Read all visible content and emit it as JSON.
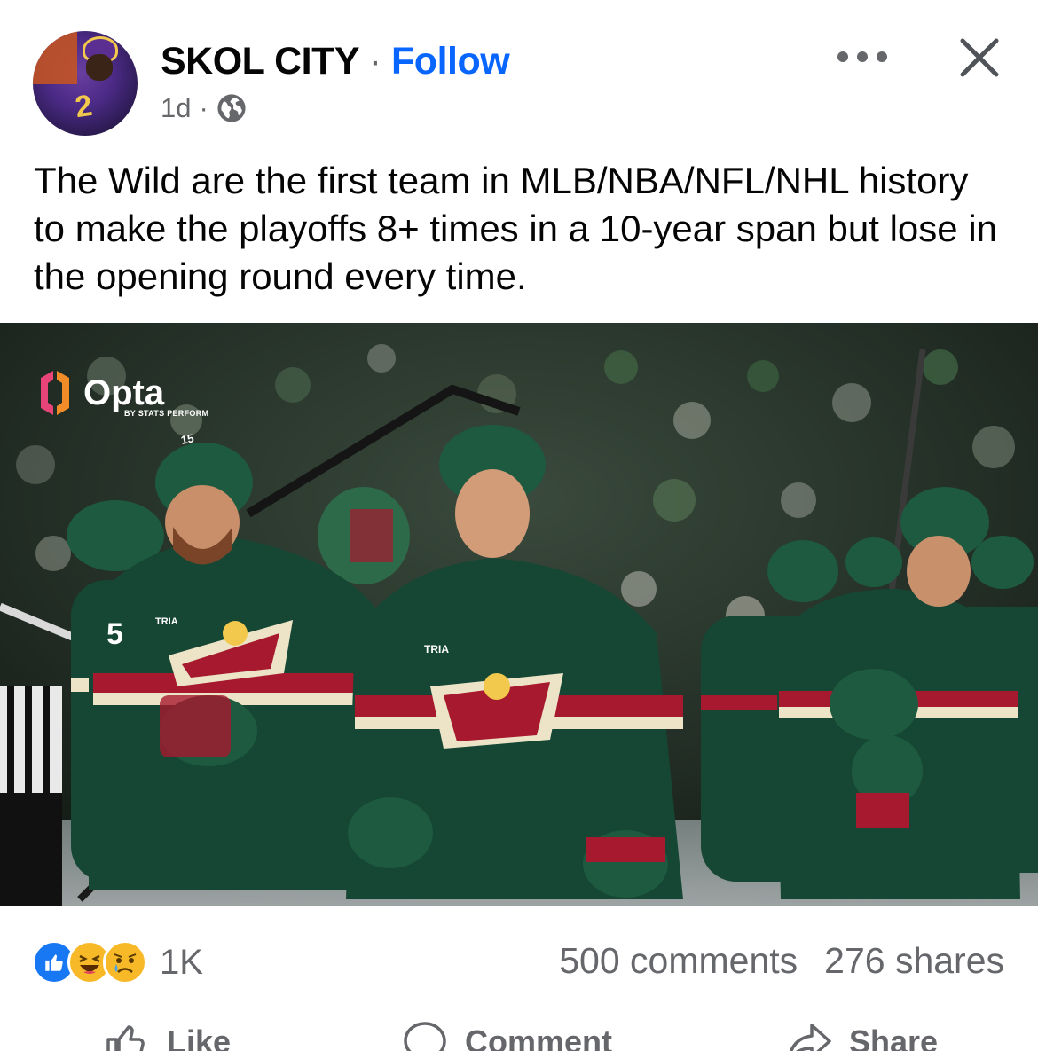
{
  "post": {
    "author": "SKOL CITY",
    "separator": "·",
    "follow_label": "Follow",
    "time": "1d",
    "time_separator": "·",
    "audience_icon": "globe-icon",
    "text": "The Wild are the first team in MLB/NBA/NFL/NHL history to make the playoffs 8+ times in a 10-year span but lose in the opening round every time."
  },
  "header_icons": {
    "more": "more-horizontal-icon",
    "close": "close-icon"
  },
  "photo": {
    "watermark_name": "Opta",
    "watermark_sub": "BY STATS PERFORM",
    "jersey_sponsor": "TRIA",
    "jersey_numbers": [
      "15",
      "5"
    ]
  },
  "stats": {
    "reactions": [
      "like-icon",
      "haha-icon",
      "sad-icon"
    ],
    "reaction_count": "1K",
    "comments": "500 comments",
    "shares": "276 shares"
  },
  "actions": [
    {
      "label": "Like",
      "icon": "thumbs-up-icon"
    },
    {
      "label": "Comment",
      "icon": "comment-icon"
    },
    {
      "label": "Share",
      "icon": "share-icon"
    }
  ],
  "colors": {
    "follow": "#0866ff",
    "secondary_text": "#65676b",
    "wild_green": "#154734",
    "wild_red": "#a6192e",
    "wild_cream": "#ede4c8"
  }
}
